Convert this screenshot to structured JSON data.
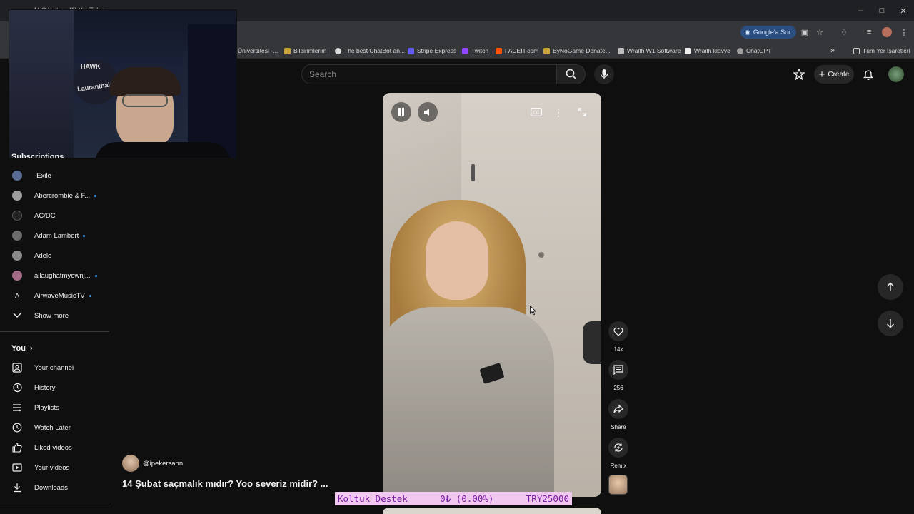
{
  "browser": {
    "tab_title": "M Çıkıntı ... (1) YouTube",
    "google_sor": "Google'a Sor",
    "bookmarks": [
      {
        "label": "Üniversitesi -..."
      },
      {
        "label": "Bildirimlerim"
      },
      {
        "label": "The best ChatBot an..."
      },
      {
        "label": "Stripe Express"
      },
      {
        "label": "Twitch"
      },
      {
        "label": "FACEIT.com"
      },
      {
        "label": "ByNoGame Donate..."
      },
      {
        "label": "Wraith W1 Software"
      },
      {
        "label": "Wraith klavye"
      },
      {
        "label": "ChatGPT"
      }
    ],
    "all_bookmarks": "Tüm Yer İşaretleri"
  },
  "webcam": {
    "cap_text": "HAWK",
    "shirt_text": "Lauranthalas"
  },
  "header": {
    "search_placeholder": "Search",
    "create_label": "Create"
  },
  "sidebar": {
    "subscriptions_title": "Subscriptions",
    "subscriptions": [
      {
        "label": "-Exile-",
        "new": false
      },
      {
        "label": "Abercrombie & F...",
        "new": true
      },
      {
        "label": "AC/DC",
        "new": false
      },
      {
        "label": "Adam Lambert",
        "new": true
      },
      {
        "label": "Adele",
        "new": false
      },
      {
        "label": "ailaughatmyownj...",
        "new": true
      },
      {
        "label": "AirwaveMusicTV",
        "new": true
      }
    ],
    "show_more": "Show more",
    "you_title": "You",
    "you_items": [
      {
        "label": "Your channel",
        "icon": "person-icon"
      },
      {
        "label": "History",
        "icon": "history-icon"
      },
      {
        "label": "Playlists",
        "icon": "playlists-icon"
      },
      {
        "label": "Watch Later",
        "icon": "clock-icon"
      },
      {
        "label": "Liked videos",
        "icon": "thumb-up-icon"
      },
      {
        "label": "Your videos",
        "icon": "video-icon"
      },
      {
        "label": "Downloads",
        "icon": "download-icon"
      }
    ]
  },
  "short": {
    "channel": "@ipekersann",
    "title": "14 Şubat saçmalık mıdır? Yoo severiz midir? ...",
    "like_count": "14k",
    "comment_count": "256",
    "share_label": "Share",
    "remix_label": "Remix"
  },
  "ticker": {
    "name": "Koltuk Destek",
    "amount": "0₺ (0.00%)",
    "goal": "TRY25000"
  },
  "colors": {
    "accent": "#3ea6ff",
    "ticker_bg": "#f0c8f0",
    "ticker_text": "#7b1fa2"
  }
}
